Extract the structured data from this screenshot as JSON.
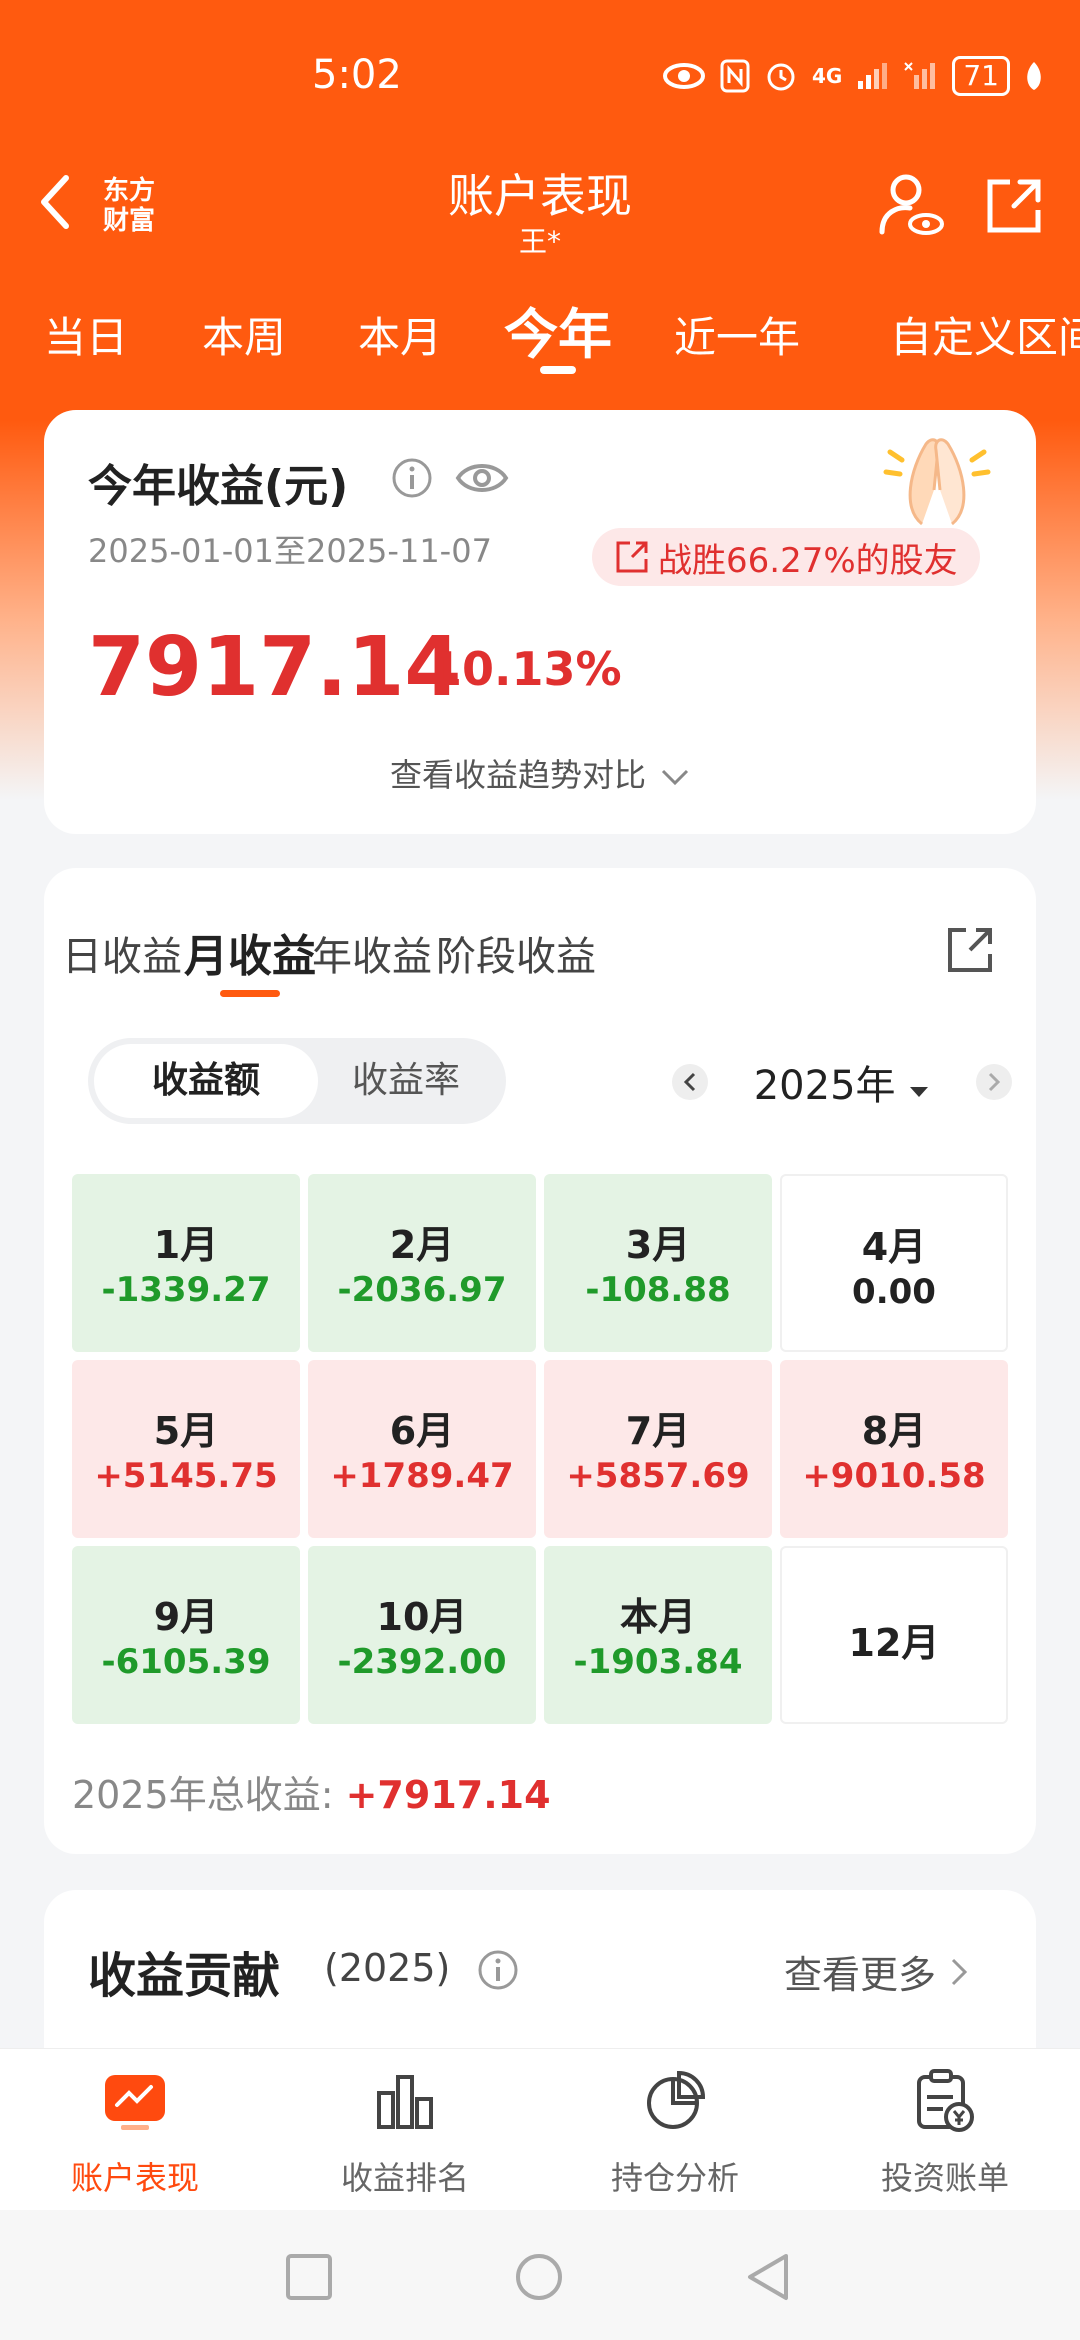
{
  "status_bar": {
    "time": "5:02",
    "network": "4G",
    "battery": "71"
  },
  "header": {
    "title": "账户表现",
    "subtitle": "王*",
    "logo_text": "东方\n财富"
  },
  "period_tabs": [
    {
      "label": "当日",
      "active": false
    },
    {
      "label": "本周",
      "active": false
    },
    {
      "label": "本月",
      "active": false
    },
    {
      "label": "今年",
      "active": true
    },
    {
      "label": "近一年",
      "active": false
    },
    {
      "label": "自定义区间",
      "active": false
    }
  ],
  "summary": {
    "title": "今年收益(元)",
    "date_range": "2025-01-01至2025-11-07",
    "beat_text": "战胜66.27%的股友",
    "profit": "7917.14",
    "rate": "10.13%",
    "trend_link": "查看收益趋势对比"
  },
  "profit_tabs": [
    {
      "label": "日收益",
      "active": false
    },
    {
      "label": "月收益",
      "active": true
    },
    {
      "label": "年收益",
      "active": false
    },
    {
      "label": "阶段收益",
      "active": false
    }
  ],
  "toggle": {
    "selected": "收益额",
    "other": "收益率"
  },
  "year_selector": {
    "label": "2025年"
  },
  "months": [
    {
      "month": "1月",
      "value": "-1339.27",
      "kind": "neg"
    },
    {
      "month": "2月",
      "value": "-2036.97",
      "kind": "neg"
    },
    {
      "month": "3月",
      "value": "-108.88",
      "kind": "neg"
    },
    {
      "month": "4月",
      "value": "0.00",
      "kind": "zero"
    },
    {
      "month": "5月",
      "value": "+5145.75",
      "kind": "pos"
    },
    {
      "month": "6月",
      "value": "+1789.47",
      "kind": "pos"
    },
    {
      "month": "7月",
      "value": "+5857.69",
      "kind": "pos"
    },
    {
      "month": "8月",
      "value": "+9010.58",
      "kind": "pos"
    },
    {
      "month": "9月",
      "value": "-6105.39",
      "kind": "neg"
    },
    {
      "month": "10月",
      "value": "-2392.00",
      "kind": "neg"
    },
    {
      "month": "本月",
      "value": "-1903.84",
      "kind": "neg"
    },
    {
      "month": "12月",
      "value": "",
      "kind": "zero"
    }
  ],
  "total": {
    "label": "2025年总收益: ",
    "value": "+7917.14"
  },
  "contribution": {
    "title": "收益贡献",
    "year": "(2025)",
    "more": "查看更多"
  },
  "bottom_nav": [
    {
      "label": "账户表现",
      "icon": "chart-screen-icon",
      "active": true
    },
    {
      "label": "收益排名",
      "icon": "bar-chart-icon",
      "active": false
    },
    {
      "label": "持仓分析",
      "icon": "pie-chart-icon",
      "active": false
    },
    {
      "label": "投资账单",
      "icon": "bill-icon",
      "active": false
    }
  ],
  "colors": {
    "brand": "#ff5a0f",
    "gain": "#e0302f",
    "loss": "#1f9a2a"
  }
}
